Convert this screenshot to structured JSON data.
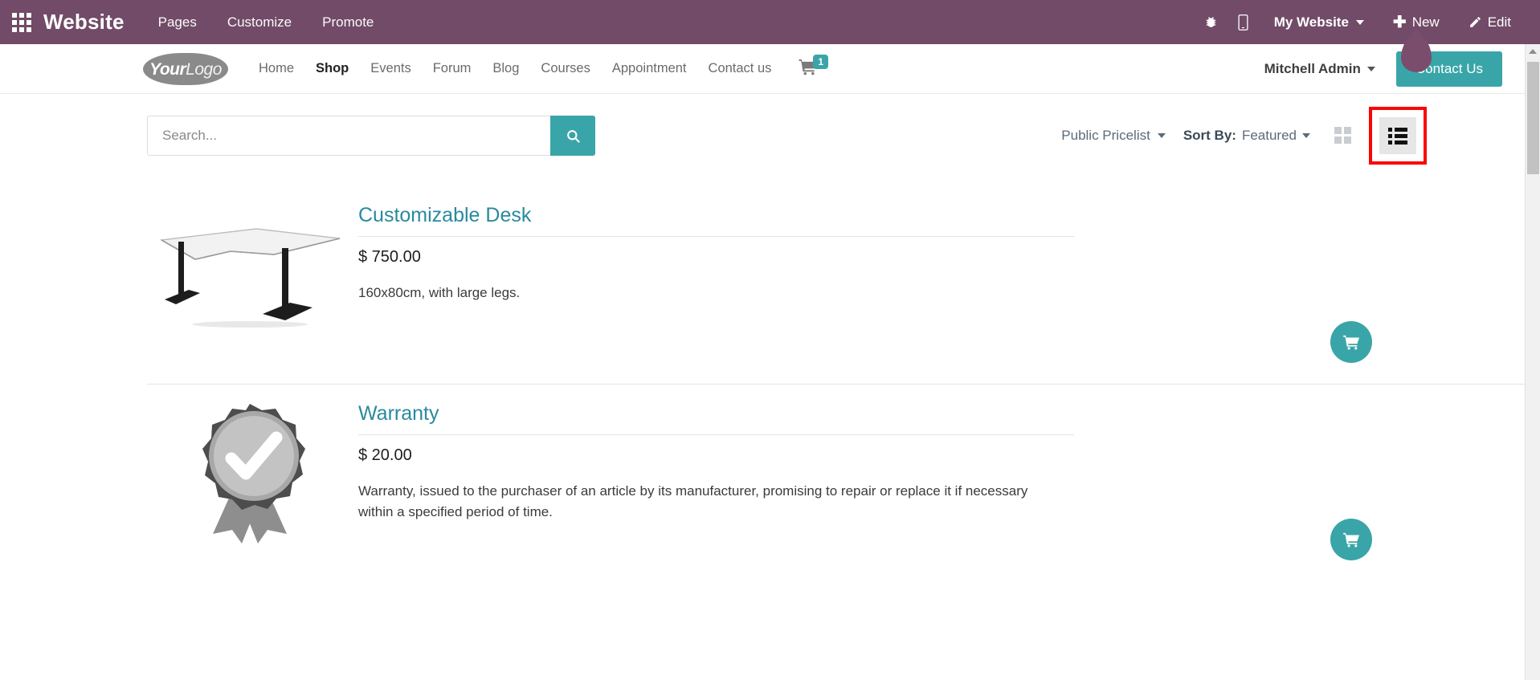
{
  "systembar": {
    "apps_icon": "apps-grid-icon",
    "brand": "Website",
    "menu": [
      {
        "label": "Pages"
      },
      {
        "label": "Customize"
      },
      {
        "label": "Promote"
      }
    ],
    "right": {
      "debug_icon": "bug-icon",
      "mobile_icon": "mobile-preview-icon",
      "website_selector": "My Website",
      "new_label": "New",
      "new_icon": "plus-icon",
      "edit_label": "Edit",
      "edit_icon": "pencil-icon"
    },
    "background_color": "#714B67"
  },
  "site_header": {
    "logo_text_bold": "Your",
    "logo_text_light": "Logo",
    "nav": [
      {
        "label": "Home",
        "active": false
      },
      {
        "label": "Shop",
        "active": true
      },
      {
        "label": "Events",
        "active": false
      },
      {
        "label": "Forum",
        "active": false
      },
      {
        "label": "Blog",
        "active": false
      },
      {
        "label": "Courses",
        "active": false
      },
      {
        "label": "Appointment",
        "active": false
      },
      {
        "label": "Contact us",
        "active": false
      }
    ],
    "cart": {
      "icon": "shopping-cart-icon",
      "count": "1"
    },
    "user": "Mitchell Admin",
    "cta_label": "Contact Us",
    "accent_color": "#3AA5A8"
  },
  "shop_toolbar": {
    "search": {
      "placeholder": "Search...",
      "value": "",
      "button_icon": "search-icon"
    },
    "pricelist": "Public Pricelist",
    "sort_by_label": "Sort By:",
    "sort_by_value": "Featured",
    "view_grid_icon": "grid-view-icon",
    "view_list_icon": "list-view-icon",
    "active_view": "list",
    "highlight_color": "#fa0505"
  },
  "products": [
    {
      "name": "Customizable Desk",
      "price": "$ 750.00",
      "description": "160x80cm, with large legs.",
      "image": "desk-image",
      "add_to_cart_icon": "shopping-cart-icon"
    },
    {
      "name": "Warranty",
      "price": "$ 20.00",
      "description": "Warranty, issued to the purchaser of an article by its manufacturer, promising to repair or replace it if necessary within a specified period of time.",
      "image": "warranty-badge-image",
      "add_to_cart_icon": "shopping-cart-icon"
    }
  ],
  "scrollbar": {
    "up_arrow_icon": "scroll-up-arrow-icon"
  }
}
